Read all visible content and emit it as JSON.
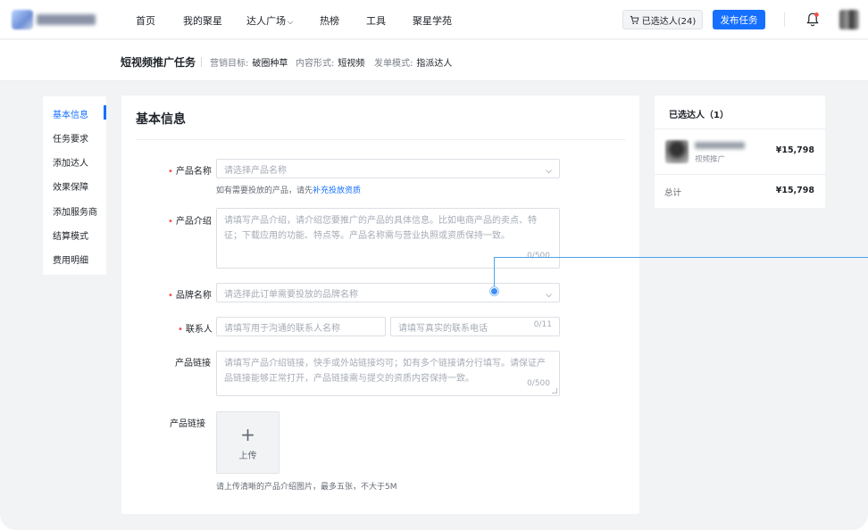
{
  "nav": {
    "items": [
      "首页",
      "我的聚星",
      "达人广场",
      "热榜",
      "工具",
      "聚星学苑"
    ],
    "selected_label": "已选达人(24)",
    "publish_label": "发布任务"
  },
  "subheader": {
    "title": "短视频推广任务",
    "goal_label": "营销目标:",
    "goal_value": "破圈种草",
    "format_label": "内容形式:",
    "format_value": "短视频",
    "mode_label": "发单模式:",
    "mode_value": "指派达人"
  },
  "leftmenu": {
    "items": [
      "基本信息",
      "任务要求",
      "添加达人",
      "效果保障",
      "添加服务商",
      "结算模式",
      "费用明细"
    ],
    "active_index": 0
  },
  "form": {
    "title": "基本信息",
    "product_name": {
      "label": "产品名称",
      "placeholder": "请选择产品名称",
      "hint_prefix": "如有需要投放的产品，请先",
      "hint_link": "补充投放资质"
    },
    "product_intro": {
      "label": "产品介绍",
      "placeholder": "请填写产品介绍，请介绍您要推广的产品的具体信息。比如电商产品的卖点、特征；下载应用的功能、特点等。产品名称需与营业执照或资质保持一致。",
      "counter": "0/500"
    },
    "brand_name": {
      "label": "品牌名称",
      "placeholder": "请选择此订单需要投放的品牌名称"
    },
    "contact": {
      "label": "联系人",
      "name_placeholder": "请填写用于沟通的联系人名称",
      "phone_placeholder": "请填写真实的联系电话",
      "phone_counter": "0/11"
    },
    "product_link": {
      "label": "产品链接",
      "placeholder": "请填写产品介绍链接，快手或外站链接均可；如有多个链接请分行填写。请保证产品链接能够正常打开，产品链接需与提交的资质内容保持一致。",
      "counter": "0/500"
    },
    "upload": {
      "label": "产品链接",
      "button_label": "上传",
      "hint": "请上传清晰的产品介绍图片，最多五张，不大于5M"
    }
  },
  "selected_panel": {
    "title": "已选达人（1）",
    "kol_type": "视频推广",
    "kol_price": "¥15,798",
    "total_label": "总计",
    "total_value": "¥15,798"
  },
  "colors": {
    "brand": "#1670ff",
    "required": "#f54a45",
    "annotation": "#4aa3f0"
  }
}
